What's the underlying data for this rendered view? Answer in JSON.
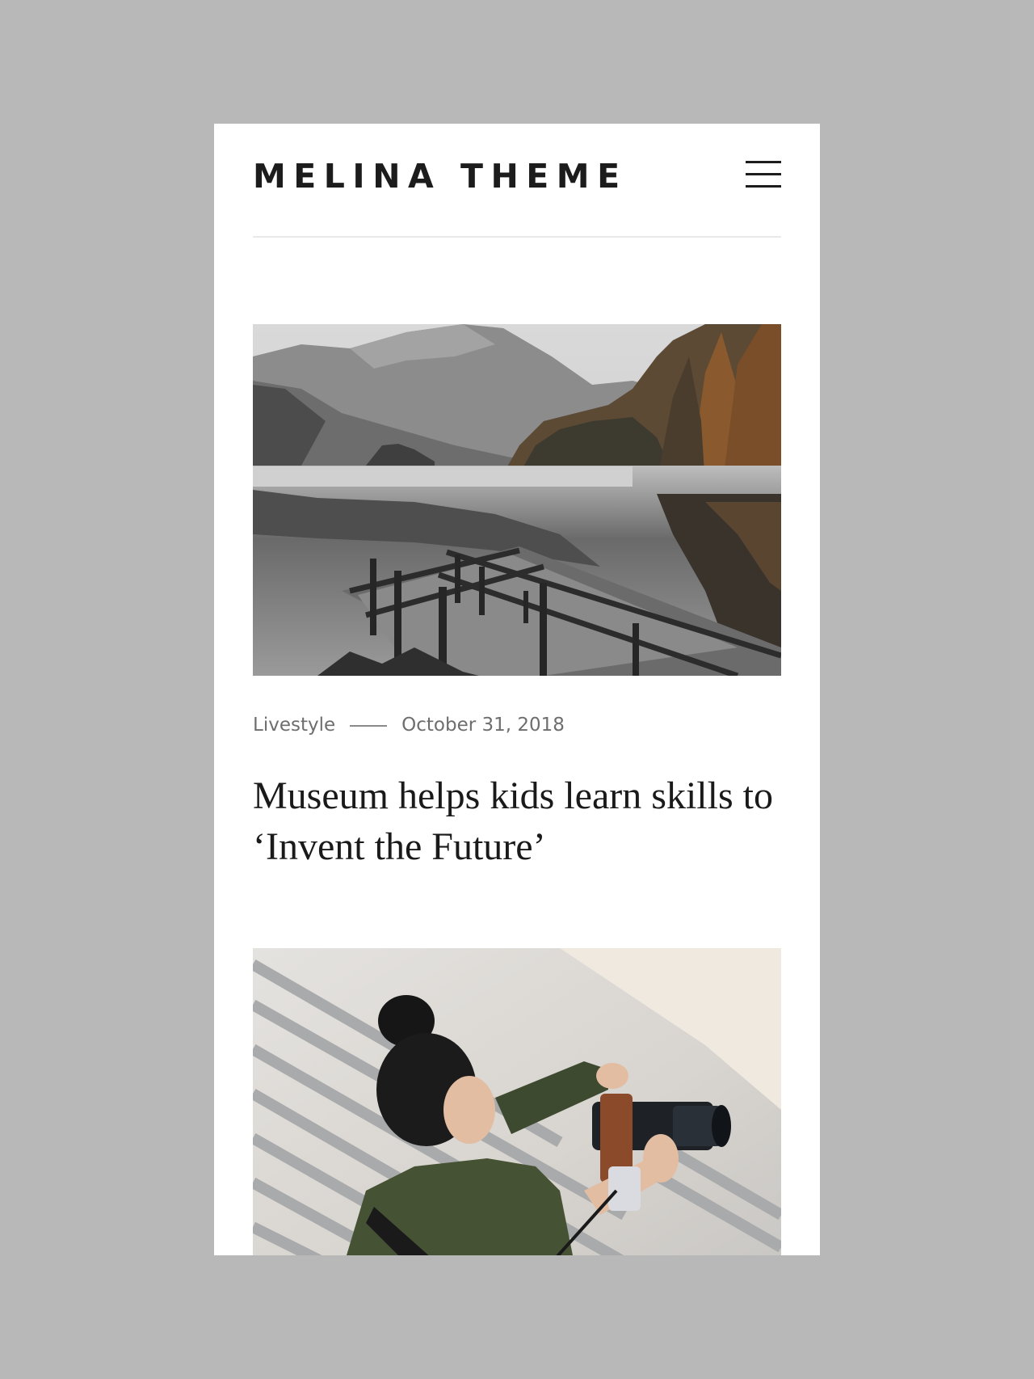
{
  "header": {
    "site_title": "MELINA THEME",
    "menu_icon": "hamburger-icon"
  },
  "posts": [
    {
      "category": "Livestyle",
      "date": "October 31, 2018",
      "title": "Museum helps kids learn skills to ‘Invent the Future’",
      "image": "lake-pier-image"
    },
    {
      "image": "photographer-image"
    }
  ],
  "colors": {
    "backdrop": "#b8b8b8",
    "page": "#ffffff",
    "text": "#1a1a1a",
    "meta": "#6e6e6e"
  }
}
